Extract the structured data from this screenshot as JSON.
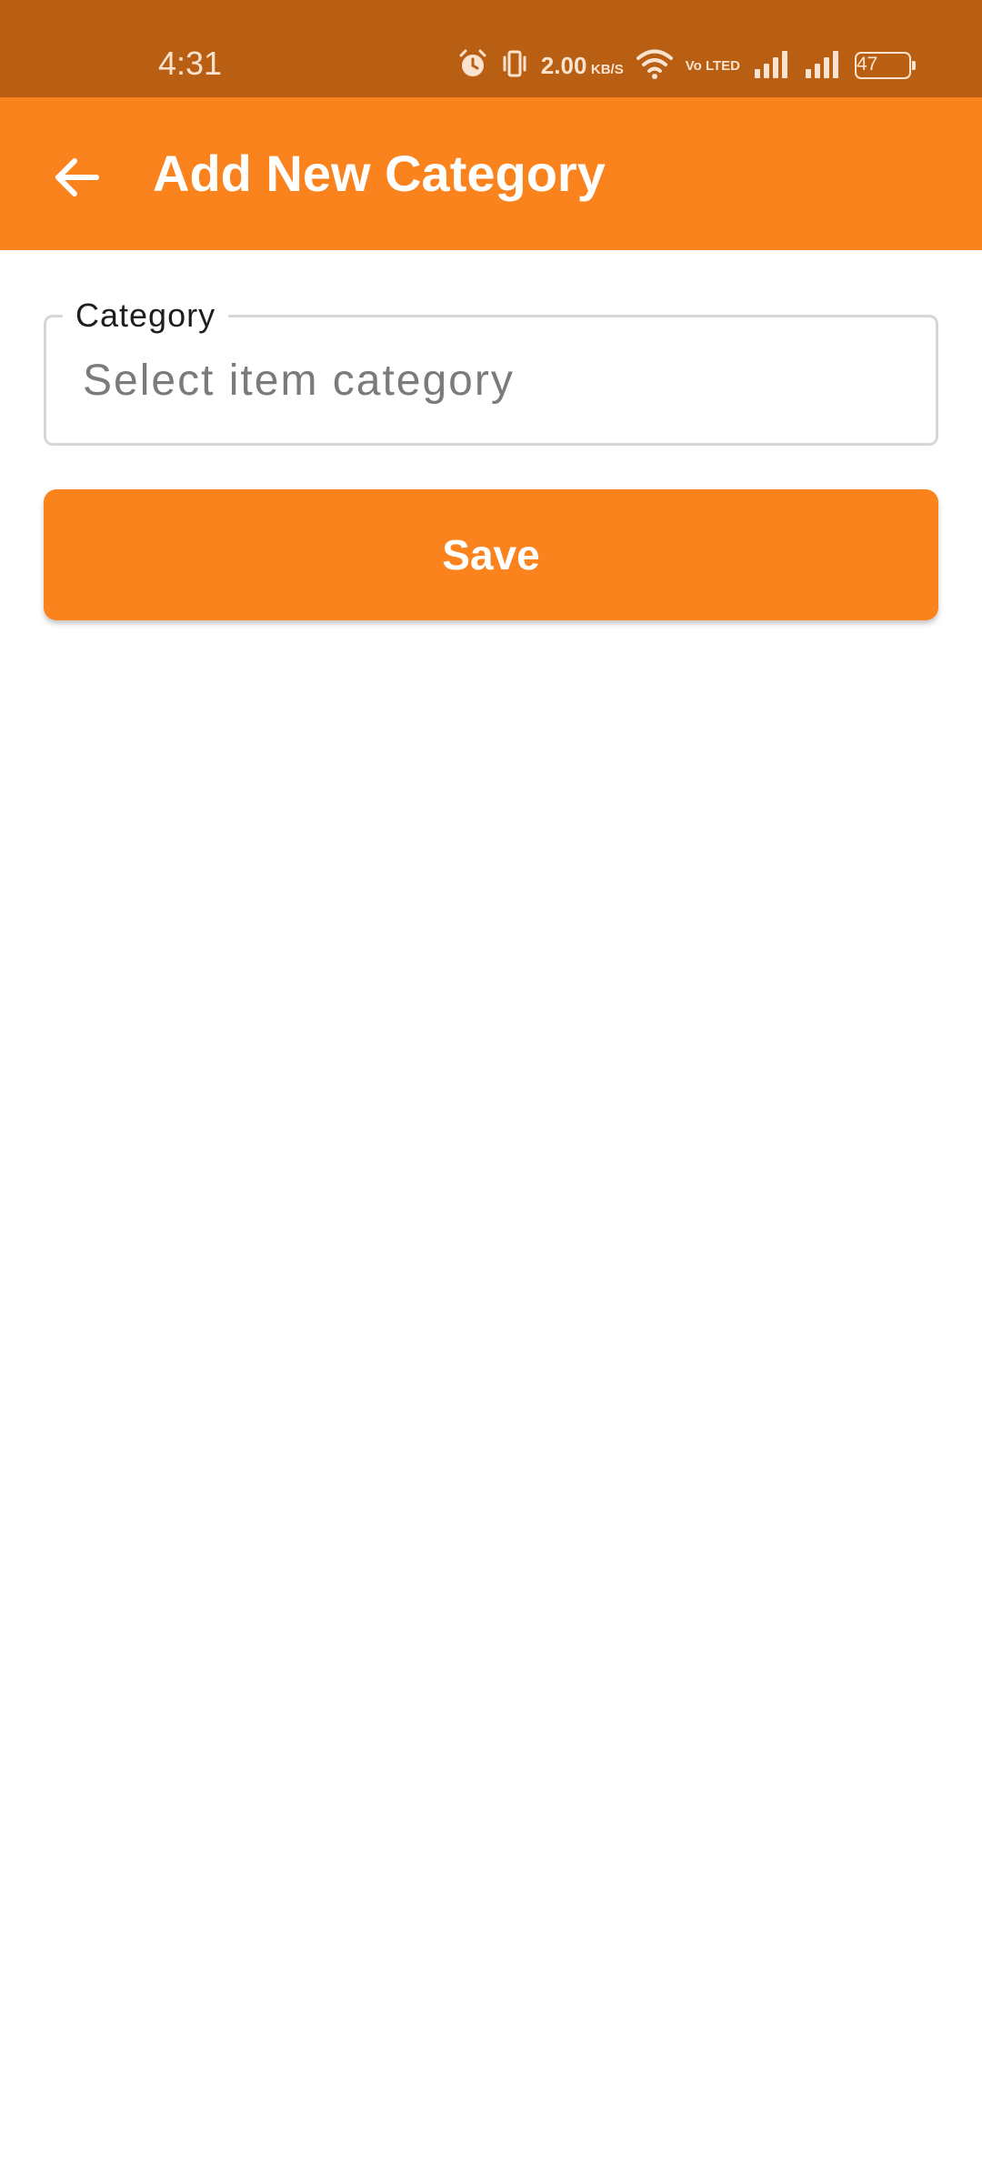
{
  "status_bar": {
    "time": "4:31",
    "network_speed_value": "2.00",
    "network_speed_unit": "KB/S",
    "volte_top": "Vo",
    "volte_bottom": "LTED",
    "battery_level": "47",
    "icons": [
      "alarm-icon",
      "vibrate-icon",
      "wifi-icon",
      "signal-icon",
      "signal-icon",
      "battery-icon"
    ],
    "color_bg": "#B95F14"
  },
  "app_bar": {
    "title": "Add New Category",
    "back_icon": "arrow-left-icon",
    "color_bg": "#FB831E"
  },
  "form": {
    "category_field": {
      "label": "Category",
      "placeholder": "Select item category",
      "value": ""
    },
    "save_label": "Save"
  },
  "colors": {
    "accent": "#FB831E",
    "status_bar": "#B95F14",
    "field_border": "#D6D6D6",
    "placeholder": "#7B7B7B"
  }
}
